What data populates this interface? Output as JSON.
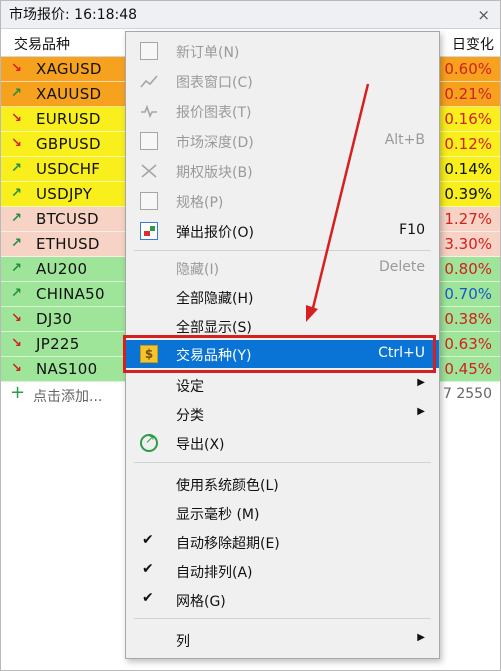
{
  "window": {
    "title": "市场报价: 16:18:48",
    "close_icon": "×"
  },
  "header": {
    "symbol_col": "交易品种",
    "change_col": "日变化"
  },
  "rows": [
    {
      "symbol": "XAGUSD",
      "change": "0.60%",
      "dir": "down",
      "bg": "#f7a21f",
      "color": "#d41f1f"
    },
    {
      "symbol": "XAUUSD",
      "change": "0.21%",
      "dir": "up",
      "bg": "#f7a21f",
      "color": "#d41f1f"
    },
    {
      "symbol": "EURUSD",
      "change": "0.16%",
      "dir": "down",
      "bg": "#f9ef1c",
      "color": "#d41f1f"
    },
    {
      "symbol": "GBPUSD",
      "change": "0.12%",
      "dir": "down",
      "bg": "#f9ef1c",
      "color": "#d41f1f"
    },
    {
      "symbol": "USDCHF",
      "change": "0.14%",
      "dir": "up",
      "bg": "#f9ef1c",
      "color": "#111111"
    },
    {
      "symbol": "USDJPY",
      "change": "0.39%",
      "dir": "up",
      "bg": "#f9ef1c",
      "color": "#111111"
    },
    {
      "symbol": "BTCUSD",
      "change": "1.27%",
      "dir": "up",
      "bg": "#f6d3c5",
      "color": "#d41f1f"
    },
    {
      "symbol": "ETHUSD",
      "change": "3.30%",
      "dir": "up",
      "bg": "#f6d3c5",
      "color": "#d41f1f"
    },
    {
      "symbol": "AU200",
      "change": "0.80%",
      "dir": "up",
      "bg": "#9ee59a",
      "color": "#d41f1f"
    },
    {
      "symbol": "CHINA50",
      "change": "0.70%",
      "dir": "up",
      "bg": "#9ee59a",
      "color": "#1a56c8"
    },
    {
      "symbol": "DJ30",
      "change": "0.38%",
      "dir": "down",
      "bg": "#9ee59a",
      "color": "#d41f1f"
    },
    {
      "symbol": "JP225",
      "change": "0.63%",
      "dir": "down",
      "bg": "#9ee59a",
      "color": "#d41f1f"
    },
    {
      "symbol": "NAS100",
      "change": "0.45%",
      "dir": "down",
      "bg": "#9ee59a",
      "color": "#d41f1f"
    }
  ],
  "add_row": {
    "label": "点击添加...",
    "count": "7 2550"
  },
  "menu": {
    "new_order": "新订单(N)",
    "chart_window": "图表窗口(C)",
    "tick_chart": "报价图表(T)",
    "depth": "市场深度(D)",
    "depth_sc": "Alt+B",
    "options": "期权版块(B)",
    "spec": "规格(P)",
    "popup": "弹出报价(O)",
    "popup_sc": "F10",
    "hide": "隐藏(I)",
    "hide_sc": "Delete",
    "hide_all": "全部隐藏(H)",
    "show_all": "全部显示(S)",
    "symbols": "交易品种(Y)",
    "symbols_sc": "Ctrl+U",
    "sets": "设定",
    "sort": "分类",
    "export": "导出(X)",
    "sys_colors": "使用系统颜色(L)",
    "show_ms": "显示毫秒 (M)",
    "auto_remove": "自动移除超期(E)",
    "auto_arrange": "自动排列(A)",
    "grid": "网格(G)",
    "columns": "列",
    "check": "✔",
    "submenu_arrow": "▶"
  },
  "colors": {
    "highlight": "#0a74d6",
    "annotation_red": "#d62020"
  }
}
